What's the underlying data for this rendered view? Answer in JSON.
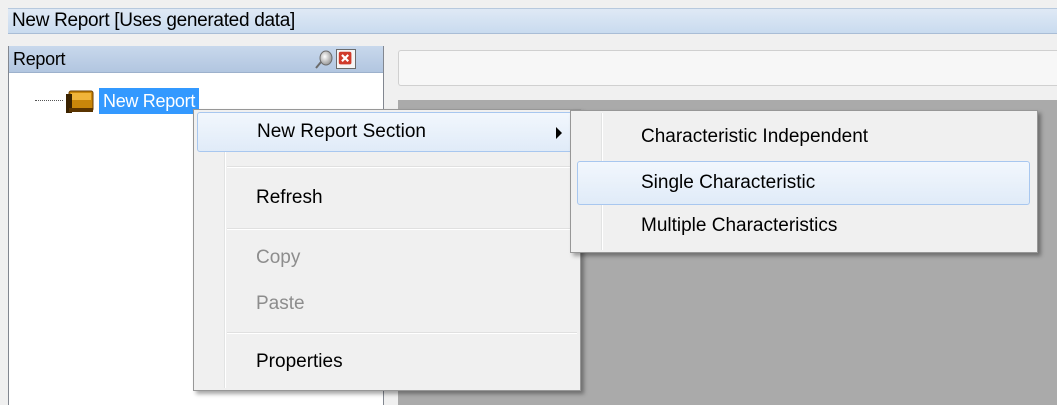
{
  "window": {
    "title": "New Report  [Uses generated data]"
  },
  "panel": {
    "title": "Report"
  },
  "tree": {
    "root_label": "New Report"
  },
  "context_menu": {
    "items": [
      {
        "label": "New Report Section",
        "has_submenu": true,
        "highlighted": true
      },
      {
        "label": "Refresh"
      },
      {
        "label": "Copy",
        "disabled": true
      },
      {
        "label": "Paste",
        "disabled": true
      },
      {
        "label": "Properties"
      }
    ]
  },
  "submenu": {
    "items": [
      {
        "label": "Characteristic Independent"
      },
      {
        "label": "Single Characteristic",
        "highlighted": true
      },
      {
        "label": "Multiple Characteristics"
      }
    ]
  },
  "colors": {
    "selection": "#3399ff",
    "menu_highlight_border": "#a8c7ef",
    "workspace": "#aaaaaa",
    "close_icon_red": "#d03a2a"
  }
}
